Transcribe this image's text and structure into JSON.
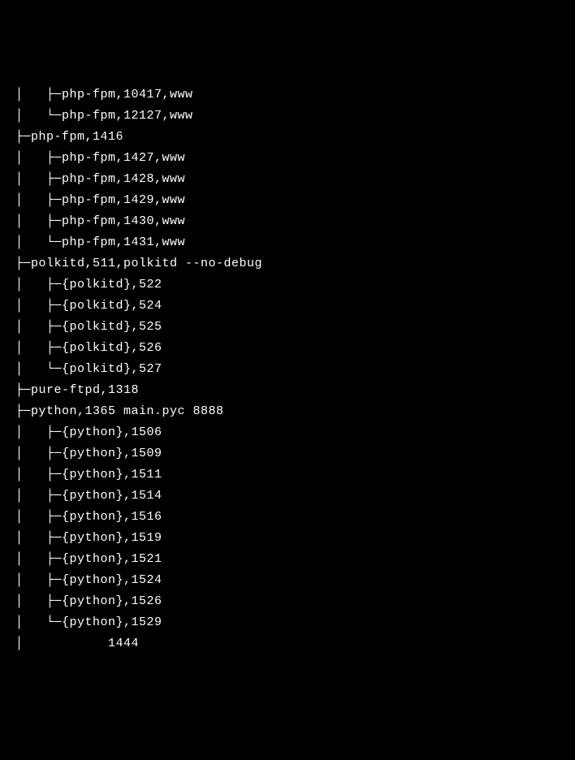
{
  "lines": [
    "  │   ├─php-fpm,10417,www",
    "  │   └─php-fpm,12127,www",
    "  ├─php-fpm,1416",
    "  │   ├─php-fpm,1427,www",
    "  │   ├─php-fpm,1428,www",
    "  │   ├─php-fpm,1429,www",
    "  │   ├─php-fpm,1430,www",
    "  │   └─php-fpm,1431,www",
    "  ├─polkitd,511,polkitd --no-debug",
    "  │   ├─{polkitd},522",
    "  │   ├─{polkitd},524",
    "  │   ├─{polkitd},525",
    "  │   ├─{polkitd},526",
    "  │   └─{polkitd},527",
    "  ├─pure-ftpd,1318",
    "  ├─python,1365 main.pyc 8888",
    "  │   ├─{python},1506",
    "  │   ├─{python},1509",
    "  │   ├─{python},1511",
    "  │   ├─{python},1514",
    "  │   ├─{python},1516",
    "  │   ├─{python},1519",
    "  │   ├─{python},1521",
    "  │   ├─{python},1524",
    "  │   ├─{python},1526",
    "  │   └─{python},1529",
    "  │           1444"
  ]
}
